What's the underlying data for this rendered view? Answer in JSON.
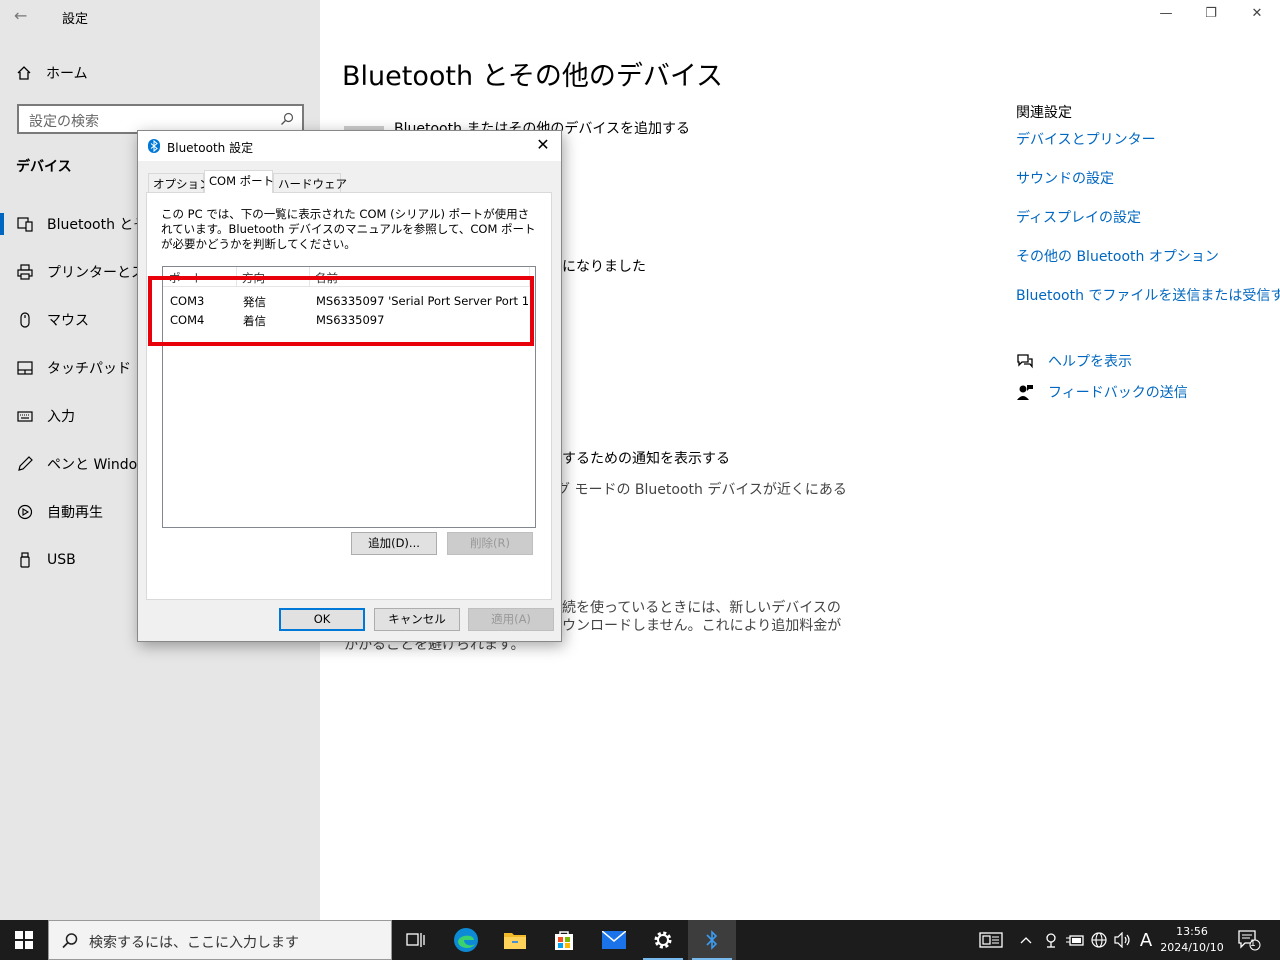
{
  "window": {
    "app_title": "設定",
    "back_glyph": "←",
    "controls": {
      "minimize": "—",
      "restore": "❐",
      "close": "✕"
    }
  },
  "nav": {
    "home_label": "ホーム",
    "search_placeholder": "設定の検索",
    "section_title": "デバイス",
    "items": [
      {
        "label": "Bluetooth とその",
        "icon": "bluetooth-device-icon",
        "active": true
      },
      {
        "label": "プリンターとスキャ",
        "icon": "printer-icon"
      },
      {
        "label": "マウス",
        "icon": "mouse-icon"
      },
      {
        "label": "タッチパッド",
        "icon": "touchpad-icon"
      },
      {
        "label": "入力",
        "icon": "keyboard-icon"
      },
      {
        "label": "ペンと Windows",
        "icon": "pen-icon"
      },
      {
        "label": "自動再生",
        "icon": "autoplay-icon"
      },
      {
        "label": "USB",
        "icon": "usb-icon"
      }
    ]
  },
  "main": {
    "title": "Bluetooth とその他のデバイス",
    "add_device_label": "Bluetooth またはその他のデバイスを追加する",
    "fragments": {
      "discoverable": "になりました",
      "swift_pair_title": "するための通知を表示する",
      "swift_pair_desc": "グ モードの Bluetooth デバイスが近くにある",
      "metered_line1": "続を使っているときには、新しいデバイスの",
      "metered_line2": "ウンロードしません。これにより追加料金が",
      "metered_line3": "かかることを避けられます。"
    }
  },
  "related": {
    "heading": "関連設定",
    "links": [
      "デバイスとプリンター",
      "サウンドの設定",
      "ディスプレイの設定",
      "その他の Bluetooth オプション",
      "Bluetooth でファイルを送信または受信する"
    ],
    "help_label": "ヘルプを表示",
    "feedback_label": "フィードバックの送信"
  },
  "dialog": {
    "title": "Bluetooth 設定",
    "close_glyph": "✕",
    "tabs": [
      "オプション",
      "COM ポート",
      "ハードウェア"
    ],
    "selected_tab": "COM ポート",
    "description": "この PC では、下の一覧に表示された COM (シリアル) ポートが使用されています。Bluetooth デバイスのマニュアルを参照して、COM ポートが必要かどうかを判断してください。",
    "columns": [
      "ポート",
      "方向",
      "名前"
    ],
    "rows": [
      {
        "port": "COM3",
        "direction": "発信",
        "name": "MS6335097 'Serial Port Server Port 1'"
      },
      {
        "port": "COM4",
        "direction": "着信",
        "name": "MS6335097"
      }
    ],
    "add_button": "追加(D)...",
    "remove_button": "削除(R)",
    "ok_button": "OK",
    "cancel_button": "キャンセル",
    "apply_button": "適用(A)"
  },
  "taskbar": {
    "search_placeholder": "検索するには、ここに入力します",
    "time": "13:56",
    "date": "2024/10/10",
    "notification_count": "1",
    "ime_indicator": "A"
  }
}
